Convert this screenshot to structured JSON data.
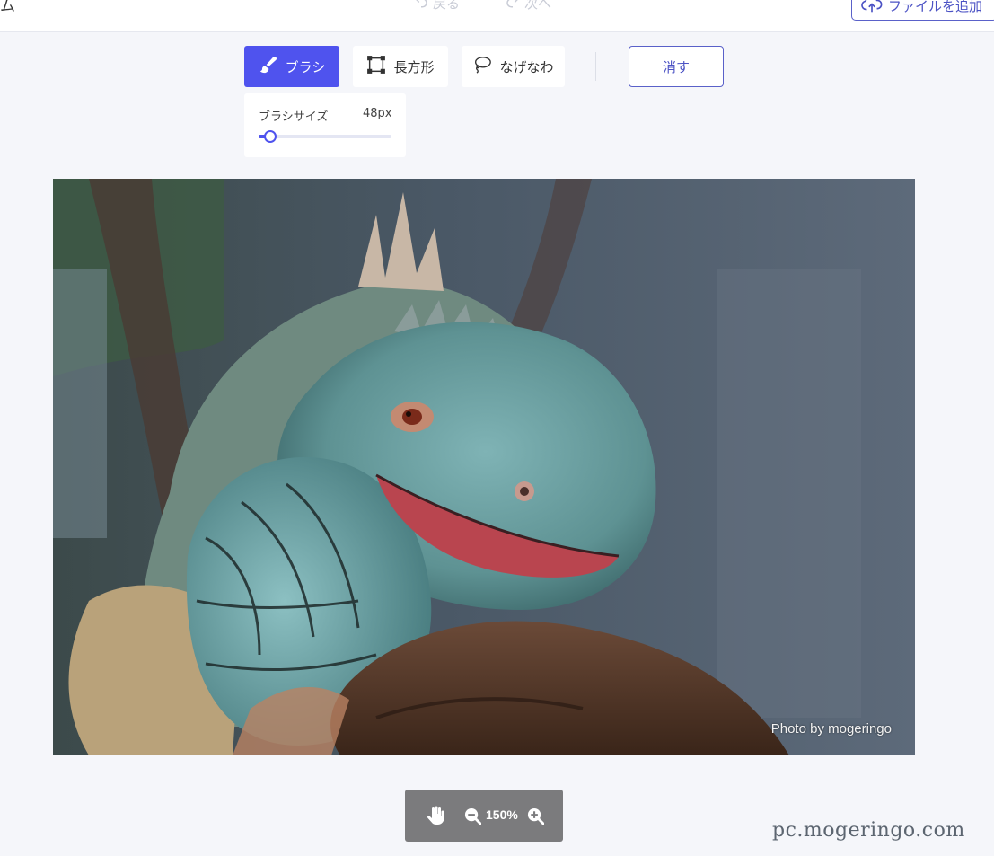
{
  "header": {
    "title_fragment": "ム",
    "undo_label": "戻る",
    "redo_label": "次へ",
    "add_file_label": "ファイルを追加"
  },
  "toolbar": {
    "brush_label": "ブラシ",
    "rectangle_label": "長方形",
    "lasso_label": "なげなわ",
    "clear_label": "消す",
    "active_tool": "brush"
  },
  "brush_size": {
    "label": "ブラシサイズ",
    "value": "48px",
    "slider_fraction": 0.09
  },
  "canvas": {
    "photo_credit": "Photo by mogeringo"
  },
  "zoom": {
    "level": "150%"
  },
  "watermark": "pc.mogeringo.com",
  "colors": {
    "accent": "#4f53ee",
    "accent_border": "#5a61c9",
    "zoom_bar": "#7b7b7d",
    "background": "#f5f6fa"
  },
  "icons": {
    "undo": "undo-icon",
    "redo": "redo-icon",
    "upload": "cloud-upload-icon",
    "brush": "brush-icon",
    "rectangle": "rectangle-icon",
    "lasso": "lasso-icon",
    "hand": "hand-icon",
    "zoom_out": "zoom-out-icon",
    "zoom_in": "zoom-in-icon"
  }
}
